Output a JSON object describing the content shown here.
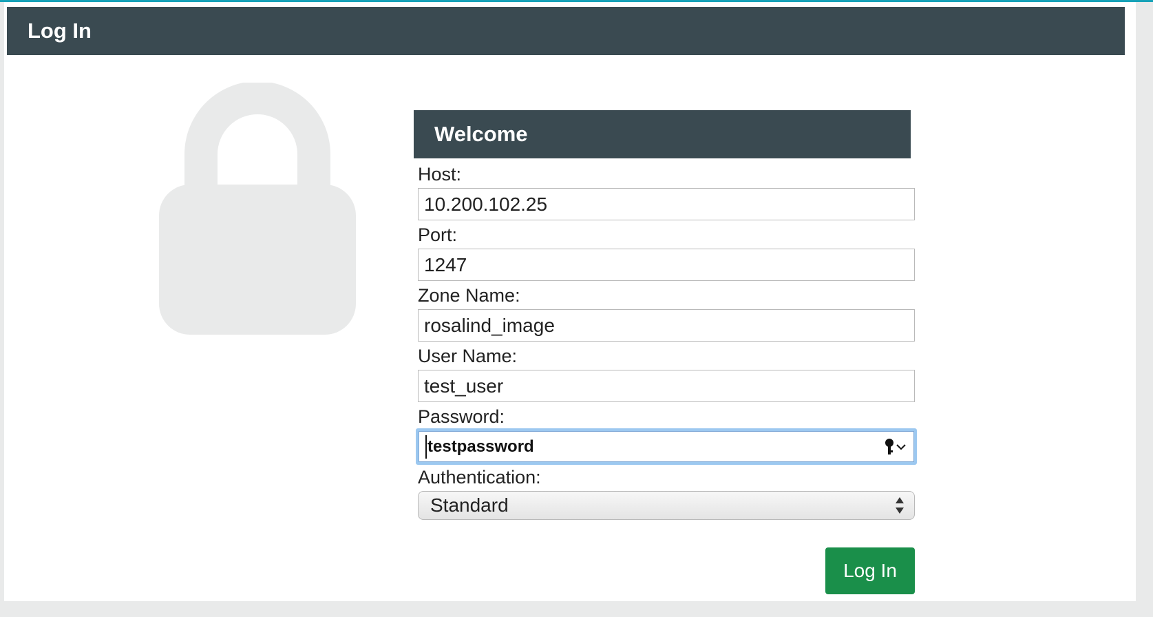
{
  "colors": {
    "accent_top": "#17a2b8",
    "header_bg": "#3a4a51",
    "lock_color": "#e9eaea",
    "button_bg": "#1a8f4a"
  },
  "header": {
    "title": "Log In"
  },
  "lock": {
    "icon": "lock-icon"
  },
  "form": {
    "title": "Welcome",
    "host": {
      "label": "Host:",
      "value": "10.200.102.25"
    },
    "port": {
      "label": "Port:",
      "value": "1247"
    },
    "zone": {
      "label": "Zone Name:",
      "value": "rosalind_image"
    },
    "user": {
      "label": "User Name:",
      "value": "test_user"
    },
    "password": {
      "label": "Password:",
      "value": "testpassword",
      "icon": "key-icon"
    },
    "authentication": {
      "label": "Authentication:",
      "selected": "Standard",
      "icon": "select-arrows-icon"
    },
    "submit_label": "Log In"
  }
}
